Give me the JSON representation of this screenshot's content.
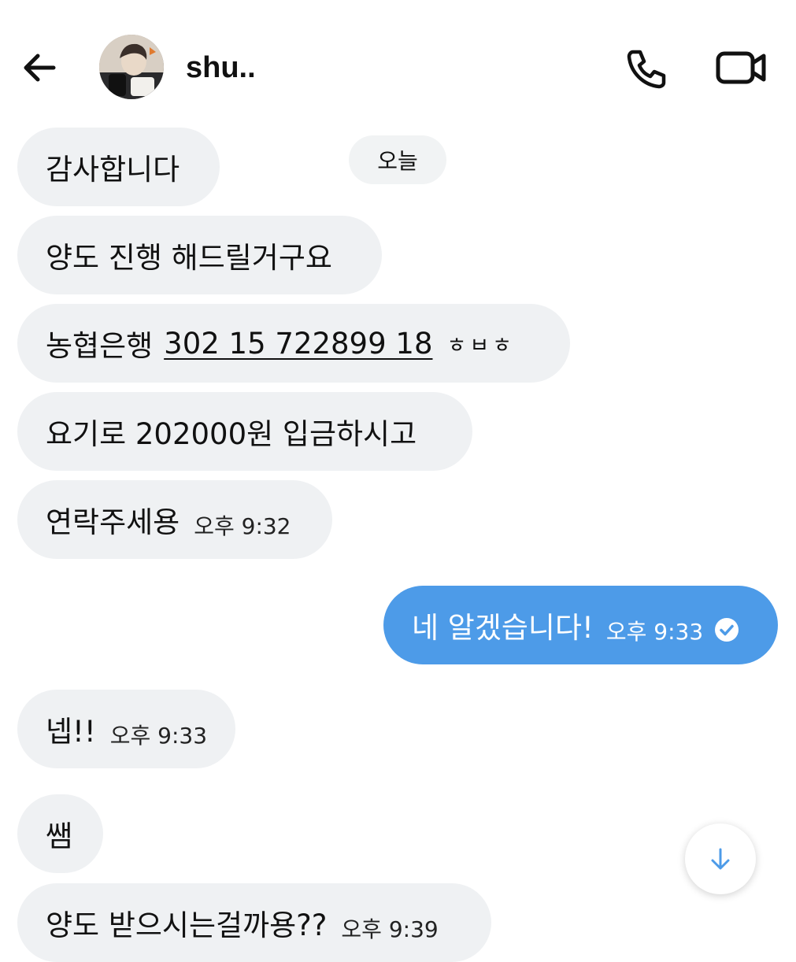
{
  "header": {
    "contact_name": "shu.."
  },
  "date_separator": "오늘",
  "messages": [
    {
      "text": "감사합니다"
    },
    {
      "text": "양도 진행 해드릴거구요"
    },
    {
      "prefix": "농협은행",
      "account": "302 15 722899 18",
      "holder": "ㅎㅂㅎ"
    },
    {
      "text": "요기로 202000원 입금하시고"
    },
    {
      "text": "연락주세용",
      "time": "오후 9:32"
    },
    {
      "text": "네 알겠습니다!",
      "time": "오후 9:33",
      "status": "read"
    },
    {
      "text": "넵!!",
      "time": "오후 9:33"
    },
    {
      "text": "쌤"
    },
    {
      "text": "양도 받으시는걸까용??",
      "time": "오후 9:39"
    }
  ],
  "colors": {
    "received_bubble": "#eff1f3",
    "sent_bubble": "#4d9be8",
    "accent": "#4d9be8"
  },
  "icons": {
    "back": "arrow-left-icon",
    "call": "phone-icon",
    "video": "video-camera-icon",
    "read": "check-circle-icon",
    "scroll": "arrow-down-icon"
  }
}
